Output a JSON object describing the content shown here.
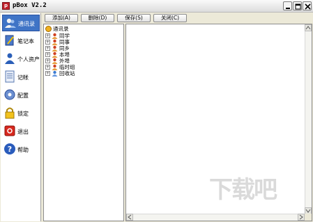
{
  "window": {
    "title": "pBox V2.2"
  },
  "sidebar": {
    "items": [
      {
        "label": "通讯录",
        "icon": "contacts-icon",
        "active": true
      },
      {
        "label": "笔记本",
        "icon": "notebook-icon",
        "active": false
      },
      {
        "label": "个人资产",
        "icon": "assets-icon",
        "active": false
      },
      {
        "label": "记帐",
        "icon": "ledger-icon",
        "active": false
      },
      {
        "label": "配置",
        "icon": "gear-icon",
        "active": false
      },
      {
        "label": "锁定",
        "icon": "lock-icon",
        "active": false
      },
      {
        "label": "退出",
        "icon": "exit-icon",
        "active": false
      },
      {
        "label": "帮助",
        "icon": "help-icon",
        "active": false
      }
    ]
  },
  "toolbar": {
    "add_label": "添加(A)",
    "delete_label": "删除(D)",
    "save_label": "保存(S)",
    "close_label": "关闭(C)"
  },
  "tree": {
    "root": "通讯录",
    "children": [
      "同学",
      "同事",
      "同乡",
      "本埠",
      "外埠",
      "临时组",
      "回收站"
    ]
  },
  "watermark": "下载吧",
  "colors": {
    "active_bg": "#3f74c6",
    "title_bg": "#f0f0f0"
  }
}
